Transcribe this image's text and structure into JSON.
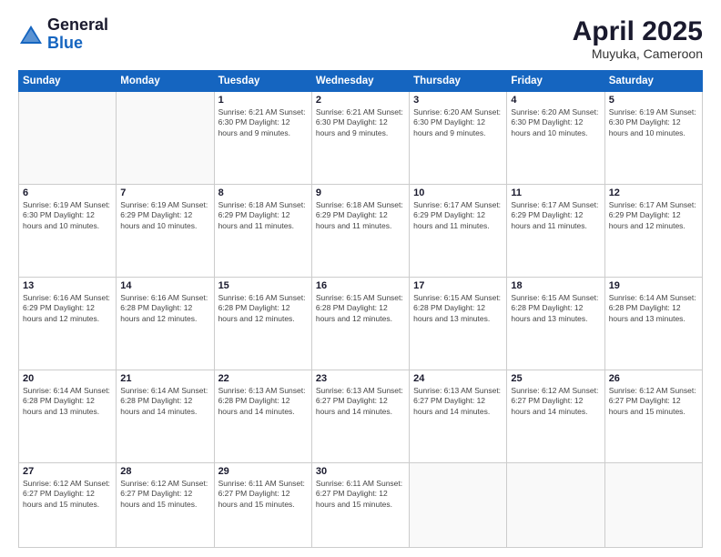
{
  "logo": {
    "general": "General",
    "blue": "Blue"
  },
  "title": {
    "month_year": "April 2025",
    "location": "Muyuka, Cameroon"
  },
  "days_of_week": [
    "Sunday",
    "Monday",
    "Tuesday",
    "Wednesday",
    "Thursday",
    "Friday",
    "Saturday"
  ],
  "weeks": [
    [
      {
        "day": "",
        "info": ""
      },
      {
        "day": "",
        "info": ""
      },
      {
        "day": "1",
        "info": "Sunrise: 6:21 AM\nSunset: 6:30 PM\nDaylight: 12 hours and 9 minutes."
      },
      {
        "day": "2",
        "info": "Sunrise: 6:21 AM\nSunset: 6:30 PM\nDaylight: 12 hours and 9 minutes."
      },
      {
        "day": "3",
        "info": "Sunrise: 6:20 AM\nSunset: 6:30 PM\nDaylight: 12 hours and 9 minutes."
      },
      {
        "day": "4",
        "info": "Sunrise: 6:20 AM\nSunset: 6:30 PM\nDaylight: 12 hours and 10 minutes."
      },
      {
        "day": "5",
        "info": "Sunrise: 6:19 AM\nSunset: 6:30 PM\nDaylight: 12 hours and 10 minutes."
      }
    ],
    [
      {
        "day": "6",
        "info": "Sunrise: 6:19 AM\nSunset: 6:30 PM\nDaylight: 12 hours and 10 minutes."
      },
      {
        "day": "7",
        "info": "Sunrise: 6:19 AM\nSunset: 6:29 PM\nDaylight: 12 hours and 10 minutes."
      },
      {
        "day": "8",
        "info": "Sunrise: 6:18 AM\nSunset: 6:29 PM\nDaylight: 12 hours and 11 minutes."
      },
      {
        "day": "9",
        "info": "Sunrise: 6:18 AM\nSunset: 6:29 PM\nDaylight: 12 hours and 11 minutes."
      },
      {
        "day": "10",
        "info": "Sunrise: 6:17 AM\nSunset: 6:29 PM\nDaylight: 12 hours and 11 minutes."
      },
      {
        "day": "11",
        "info": "Sunrise: 6:17 AM\nSunset: 6:29 PM\nDaylight: 12 hours and 11 minutes."
      },
      {
        "day": "12",
        "info": "Sunrise: 6:17 AM\nSunset: 6:29 PM\nDaylight: 12 hours and 12 minutes."
      }
    ],
    [
      {
        "day": "13",
        "info": "Sunrise: 6:16 AM\nSunset: 6:29 PM\nDaylight: 12 hours and 12 minutes."
      },
      {
        "day": "14",
        "info": "Sunrise: 6:16 AM\nSunset: 6:28 PM\nDaylight: 12 hours and 12 minutes."
      },
      {
        "day": "15",
        "info": "Sunrise: 6:16 AM\nSunset: 6:28 PM\nDaylight: 12 hours and 12 minutes."
      },
      {
        "day": "16",
        "info": "Sunrise: 6:15 AM\nSunset: 6:28 PM\nDaylight: 12 hours and 12 minutes."
      },
      {
        "day": "17",
        "info": "Sunrise: 6:15 AM\nSunset: 6:28 PM\nDaylight: 12 hours and 13 minutes."
      },
      {
        "day": "18",
        "info": "Sunrise: 6:15 AM\nSunset: 6:28 PM\nDaylight: 12 hours and 13 minutes."
      },
      {
        "day": "19",
        "info": "Sunrise: 6:14 AM\nSunset: 6:28 PM\nDaylight: 12 hours and 13 minutes."
      }
    ],
    [
      {
        "day": "20",
        "info": "Sunrise: 6:14 AM\nSunset: 6:28 PM\nDaylight: 12 hours and 13 minutes."
      },
      {
        "day": "21",
        "info": "Sunrise: 6:14 AM\nSunset: 6:28 PM\nDaylight: 12 hours and 14 minutes."
      },
      {
        "day": "22",
        "info": "Sunrise: 6:13 AM\nSunset: 6:28 PM\nDaylight: 12 hours and 14 minutes."
      },
      {
        "day": "23",
        "info": "Sunrise: 6:13 AM\nSunset: 6:27 PM\nDaylight: 12 hours and 14 minutes."
      },
      {
        "day": "24",
        "info": "Sunrise: 6:13 AM\nSunset: 6:27 PM\nDaylight: 12 hours and 14 minutes."
      },
      {
        "day": "25",
        "info": "Sunrise: 6:12 AM\nSunset: 6:27 PM\nDaylight: 12 hours and 14 minutes."
      },
      {
        "day": "26",
        "info": "Sunrise: 6:12 AM\nSunset: 6:27 PM\nDaylight: 12 hours and 15 minutes."
      }
    ],
    [
      {
        "day": "27",
        "info": "Sunrise: 6:12 AM\nSunset: 6:27 PM\nDaylight: 12 hours and 15 minutes."
      },
      {
        "day": "28",
        "info": "Sunrise: 6:12 AM\nSunset: 6:27 PM\nDaylight: 12 hours and 15 minutes."
      },
      {
        "day": "29",
        "info": "Sunrise: 6:11 AM\nSunset: 6:27 PM\nDaylight: 12 hours and 15 minutes."
      },
      {
        "day": "30",
        "info": "Sunrise: 6:11 AM\nSunset: 6:27 PM\nDaylight: 12 hours and 15 minutes."
      },
      {
        "day": "",
        "info": ""
      },
      {
        "day": "",
        "info": ""
      },
      {
        "day": "",
        "info": ""
      }
    ]
  ]
}
